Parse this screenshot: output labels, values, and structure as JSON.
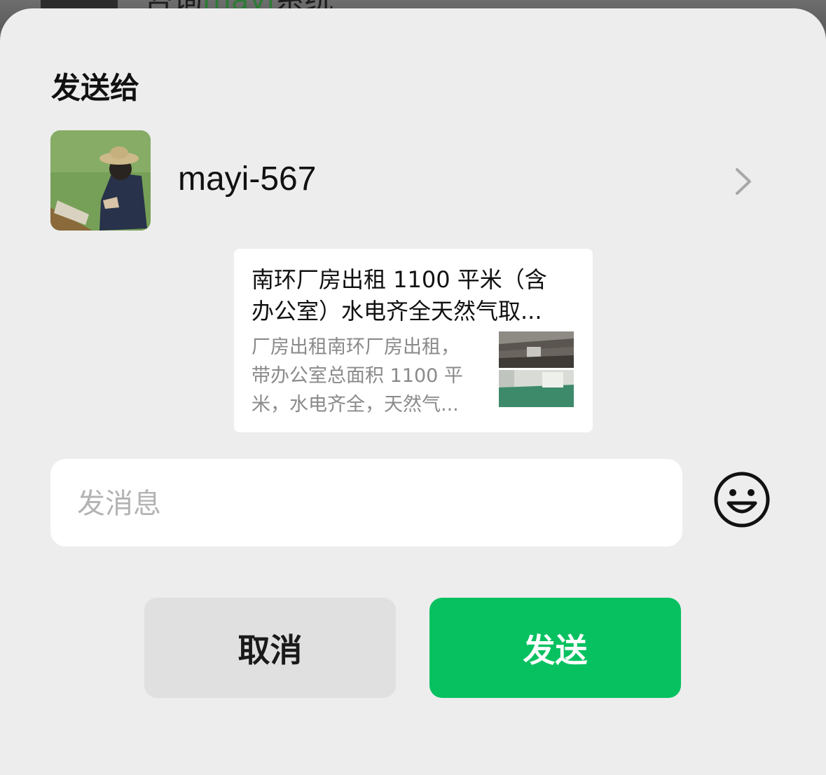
{
  "background": {
    "partial_chat_text_prefix": "咨询",
    "partial_chat_text_highlight": "mayi",
    "partial_chat_text_suffix": "系统"
  },
  "dialog": {
    "title": "发送给",
    "recipient": {
      "name": "mayi-567",
      "avatar_icon": "avatar-photo",
      "chevron_icon": "chevron-right-icon"
    },
    "shared_card": {
      "title_line1": "南环厂房出租 1100 平米（含",
      "title_line2": "办公室）水电齐全天然气取...",
      "desc_line1": "厂房出租南环厂房出租，",
      "desc_line2": "带办公室总面积 1100 平",
      "desc_line3": "米，水电齐全，天然气..."
    },
    "message_input": {
      "placeholder": "发消息",
      "value": ""
    },
    "emoji_icon": "emoji-smile-icon",
    "buttons": {
      "cancel_label": "取消",
      "send_label": "发送"
    },
    "colors": {
      "send_button": "#07c160",
      "cancel_button": "#e0e0e0",
      "sheet_background": "#ededed"
    }
  }
}
